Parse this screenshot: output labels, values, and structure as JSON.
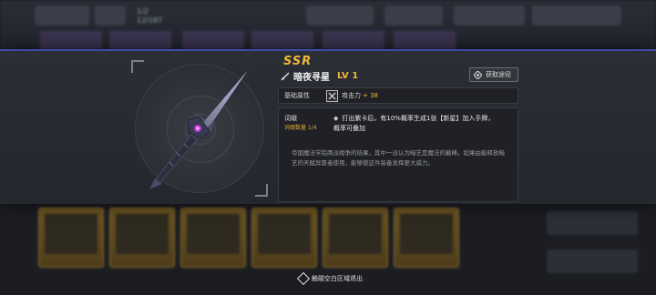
{
  "background": {
    "top_label_1": "1/2",
    "top_label_2": "12/187",
    "side_buttons": [
      "...",
      "..."
    ]
  },
  "modal": {
    "rarity": "SSR",
    "weapon_name": "暗夜寻星",
    "level": "LV 1",
    "source_button": "获取途径",
    "base_attr_label": "基础属性",
    "stat_name": "攻击力",
    "stat_value": "+ 38",
    "affix_title": "词缀",
    "affix_count": "词缀数量 1/4",
    "affix_text": "打出紫卡后，有10%概率生成1张【新星】加入手牌，概率可叠加",
    "lore": "帝国魔法学院两派相争的结果，其中一派认为暗艺是魔法的巅峰。如果由能释放暗艺的天赋异禀者使用，能够使这件装备发挥更大威力。",
    "colors": {
      "rarity": "#f2b73a",
      "accent_border": "#3b4ca8"
    }
  },
  "footer": {
    "exit_hint": "触碰空白区域退出"
  },
  "icons": {
    "weapon_small": "sword-icon",
    "source": "diamond-icon",
    "attack": "crossed-swords-icon",
    "exit": "tap-icon"
  }
}
